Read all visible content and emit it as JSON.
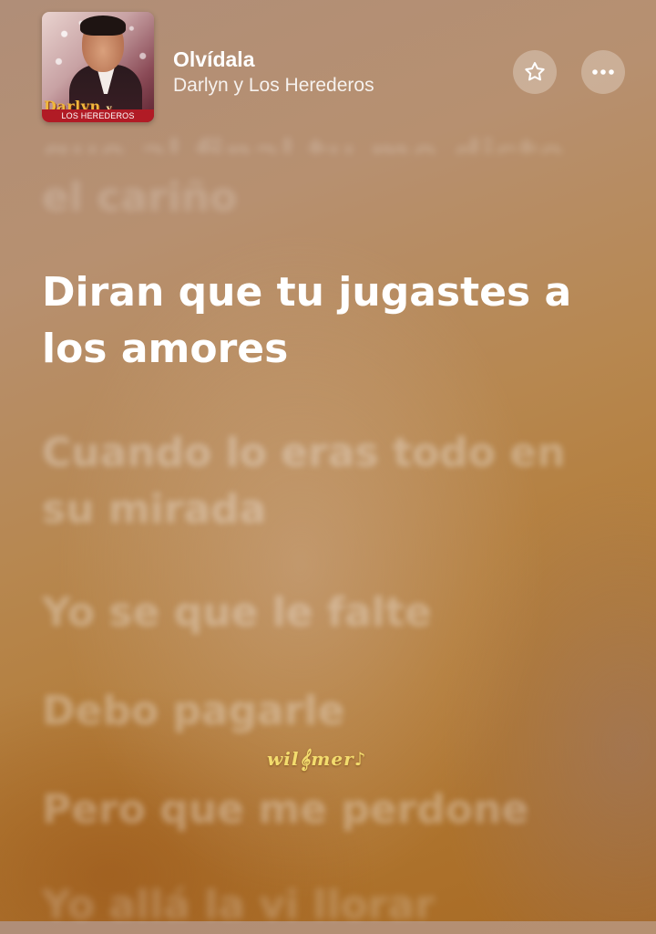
{
  "now_playing": {
    "title": "Olvídala",
    "artist": "Darlyn y Los Herederos",
    "album_art": {
      "brand_text": "Darlyn",
      "brand_small": "y",
      "band_text": "LOS HEREDEROS"
    }
  },
  "controls": {
    "favorite_icon": "star-icon",
    "more_icon": "ellipsis-icon"
  },
  "lyrics": {
    "partial_top": "que al final tu me diste todo",
    "previous": "el cariño",
    "current": "Diran que tu jugastes a los amores",
    "upcoming": [
      "Cuando lo eras todo en su mirada",
      "Yo se que le falte",
      "Debo pagarle",
      "Pero que me perdone",
      "Yo allá la vi llorar"
    ]
  },
  "watermark": "wil𝄞mer♪",
  "colors": {
    "background_top": "#b08e78",
    "background_bottom": "#a86a24",
    "current_lyric": "#ffffff",
    "watermark": "#f3dc6e"
  }
}
